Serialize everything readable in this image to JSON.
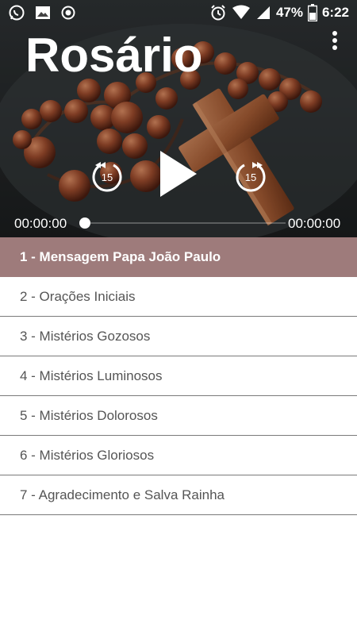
{
  "status_bar": {
    "battery": "47%",
    "time": "6:22",
    "icons": [
      "whatsapp-icon",
      "image-icon",
      "record-icon",
      "alarm-icon",
      "wifi-icon",
      "signal-icon",
      "battery-icon"
    ]
  },
  "header": {
    "title": "Rosário",
    "menu_icon": "more-vertical-icon"
  },
  "player": {
    "rewind_seconds": "15",
    "forward_seconds": "15",
    "current_time": "00:00:00",
    "total_time": "00:00:00",
    "progress": 0,
    "state": "paused"
  },
  "colors": {
    "active_row": "#9e7b7b",
    "list_text": "#555555",
    "divider": "#7a7a7a"
  },
  "playlist": {
    "active_index": 0,
    "items": [
      {
        "label": "1 - Mensagem Papa João Paulo"
      },
      {
        "label": "2 - Orações Iniciais"
      },
      {
        "label": "3 - Mistérios Gozosos"
      },
      {
        "label": "4 - Mistérios Luminosos"
      },
      {
        "label": "5 - Mistérios Dolorosos"
      },
      {
        "label": "6 - Mistérios Gloriosos"
      },
      {
        "label": "7 - Agradecimento e Salva Rainha"
      }
    ]
  }
}
